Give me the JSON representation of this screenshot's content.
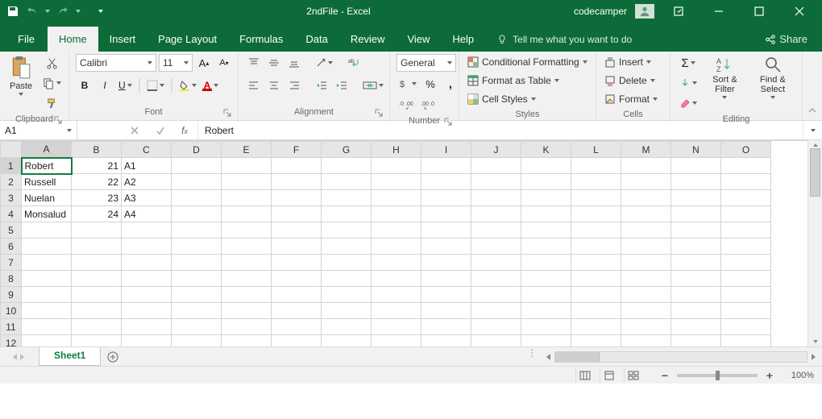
{
  "title": "2ndFile  -  Excel",
  "user": "codecamper",
  "tabs": [
    "File",
    "Home",
    "Insert",
    "Page Layout",
    "Formulas",
    "Data",
    "Review",
    "View",
    "Help"
  ],
  "activeTab": "Home",
  "tell": "Tell me what you want to do",
  "share": "Share",
  "ribbon": {
    "clipboard": {
      "paste": "Paste",
      "label": "Clipboard"
    },
    "font": {
      "name": "Calibri",
      "size": "11",
      "label": "Font"
    },
    "alignment": {
      "label": "Alignment"
    },
    "number": {
      "format": "General",
      "label": "Number"
    },
    "styles": {
      "cond": "Conditional Formatting",
      "table": "Format as Table",
      "cell": "Cell Styles",
      "label": "Styles"
    },
    "cells": {
      "insert": "Insert",
      "delete": "Delete",
      "format": "Format",
      "label": "Cells"
    },
    "editing": {
      "sort": "Sort & Filter",
      "find": "Find & Select",
      "label": "Editing"
    }
  },
  "nameBox": "A1",
  "formula": "Robert",
  "columns": [
    "A",
    "B",
    "C",
    "D",
    "E",
    "F",
    "G",
    "H",
    "I",
    "J",
    "K",
    "L",
    "M",
    "N",
    "O"
  ],
  "rows": [
    {
      "n": 1,
      "A": "Robert",
      "B": "21",
      "C": "A1"
    },
    {
      "n": 2,
      "A": "Russell",
      "B": "22",
      "C": "A2"
    },
    {
      "n": 3,
      "A": "Nuelan",
      "B": "23",
      "C": "A3"
    },
    {
      "n": 4,
      "A": "Monsalud",
      "B": "24",
      "C": "A4"
    },
    {
      "n": 5
    },
    {
      "n": 6
    },
    {
      "n": 7
    },
    {
      "n": 8
    },
    {
      "n": 9
    },
    {
      "n": 10
    },
    {
      "n": 11
    },
    {
      "n": 12
    }
  ],
  "sheet": "Sheet1",
  "zoom": "100%"
}
